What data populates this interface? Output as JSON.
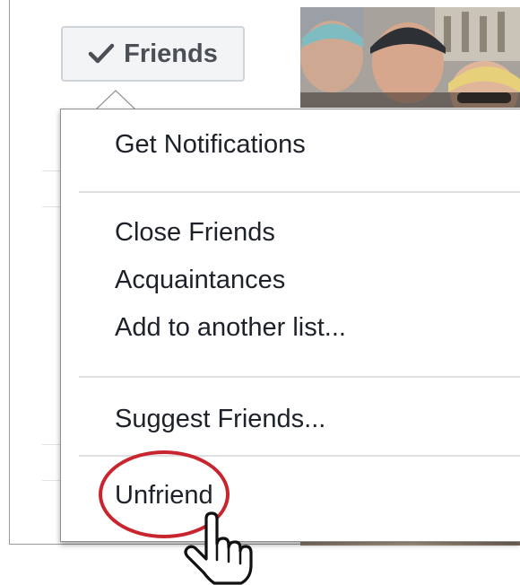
{
  "header": {
    "friends_button_label": "Friends",
    "check_icon": "check-icon"
  },
  "menu": {
    "items": [
      {
        "label": "Get Notifications"
      },
      {
        "label": "Close Friends"
      },
      {
        "label": "Acquaintances"
      },
      {
        "label": "Add to another list..."
      },
      {
        "label": "Suggest Friends..."
      },
      {
        "label": "Unfriend"
      }
    ]
  },
  "colors": {
    "button_text": "#4b4f56",
    "menu_text": "#1d2129",
    "annotation_ring": "#c8252f",
    "separator": "#dddfe2"
  },
  "icons": {
    "cursor": "hand-pointer-icon",
    "caret": "dropdown-caret"
  }
}
